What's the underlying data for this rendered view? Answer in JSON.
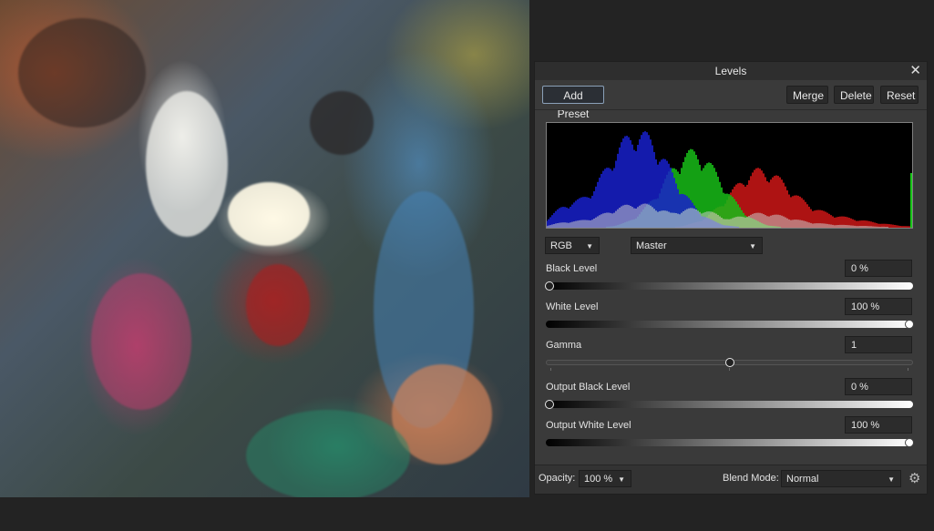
{
  "panel": {
    "title": "Levels",
    "close_glyph": "✕",
    "buttons": {
      "add_preset": "Add Preset",
      "merge": "Merge",
      "delete": "Delete",
      "reset": "Reset"
    },
    "channel_dropdown": "RGB",
    "mode_dropdown": "Master",
    "black_level": {
      "label": "Black Level",
      "value": "0 %",
      "fraction": 0.0
    },
    "white_level": {
      "label": "White Level",
      "value": "100 %",
      "fraction": 1.0
    },
    "gamma": {
      "label": "Gamma",
      "value": "1",
      "fraction": 0.5
    },
    "output_black_level": {
      "label": "Output Black Level",
      "value": "0 %",
      "fraction": 0.0
    },
    "output_white_level": {
      "label": "Output White Level",
      "value": "100 %",
      "fraction": 1.0
    },
    "footer": {
      "opacity_label": "Opacity:",
      "opacity_value": "100 %",
      "blend_mode_label": "Blend Mode:",
      "blend_mode_value": "Normal",
      "settings_icon": "gear-icon"
    },
    "colors": {
      "histogram_blue": "#1a22d8",
      "histogram_green": "#19c919",
      "histogram_red": "#d91818",
      "histogram_white": "#ffffff"
    }
  }
}
